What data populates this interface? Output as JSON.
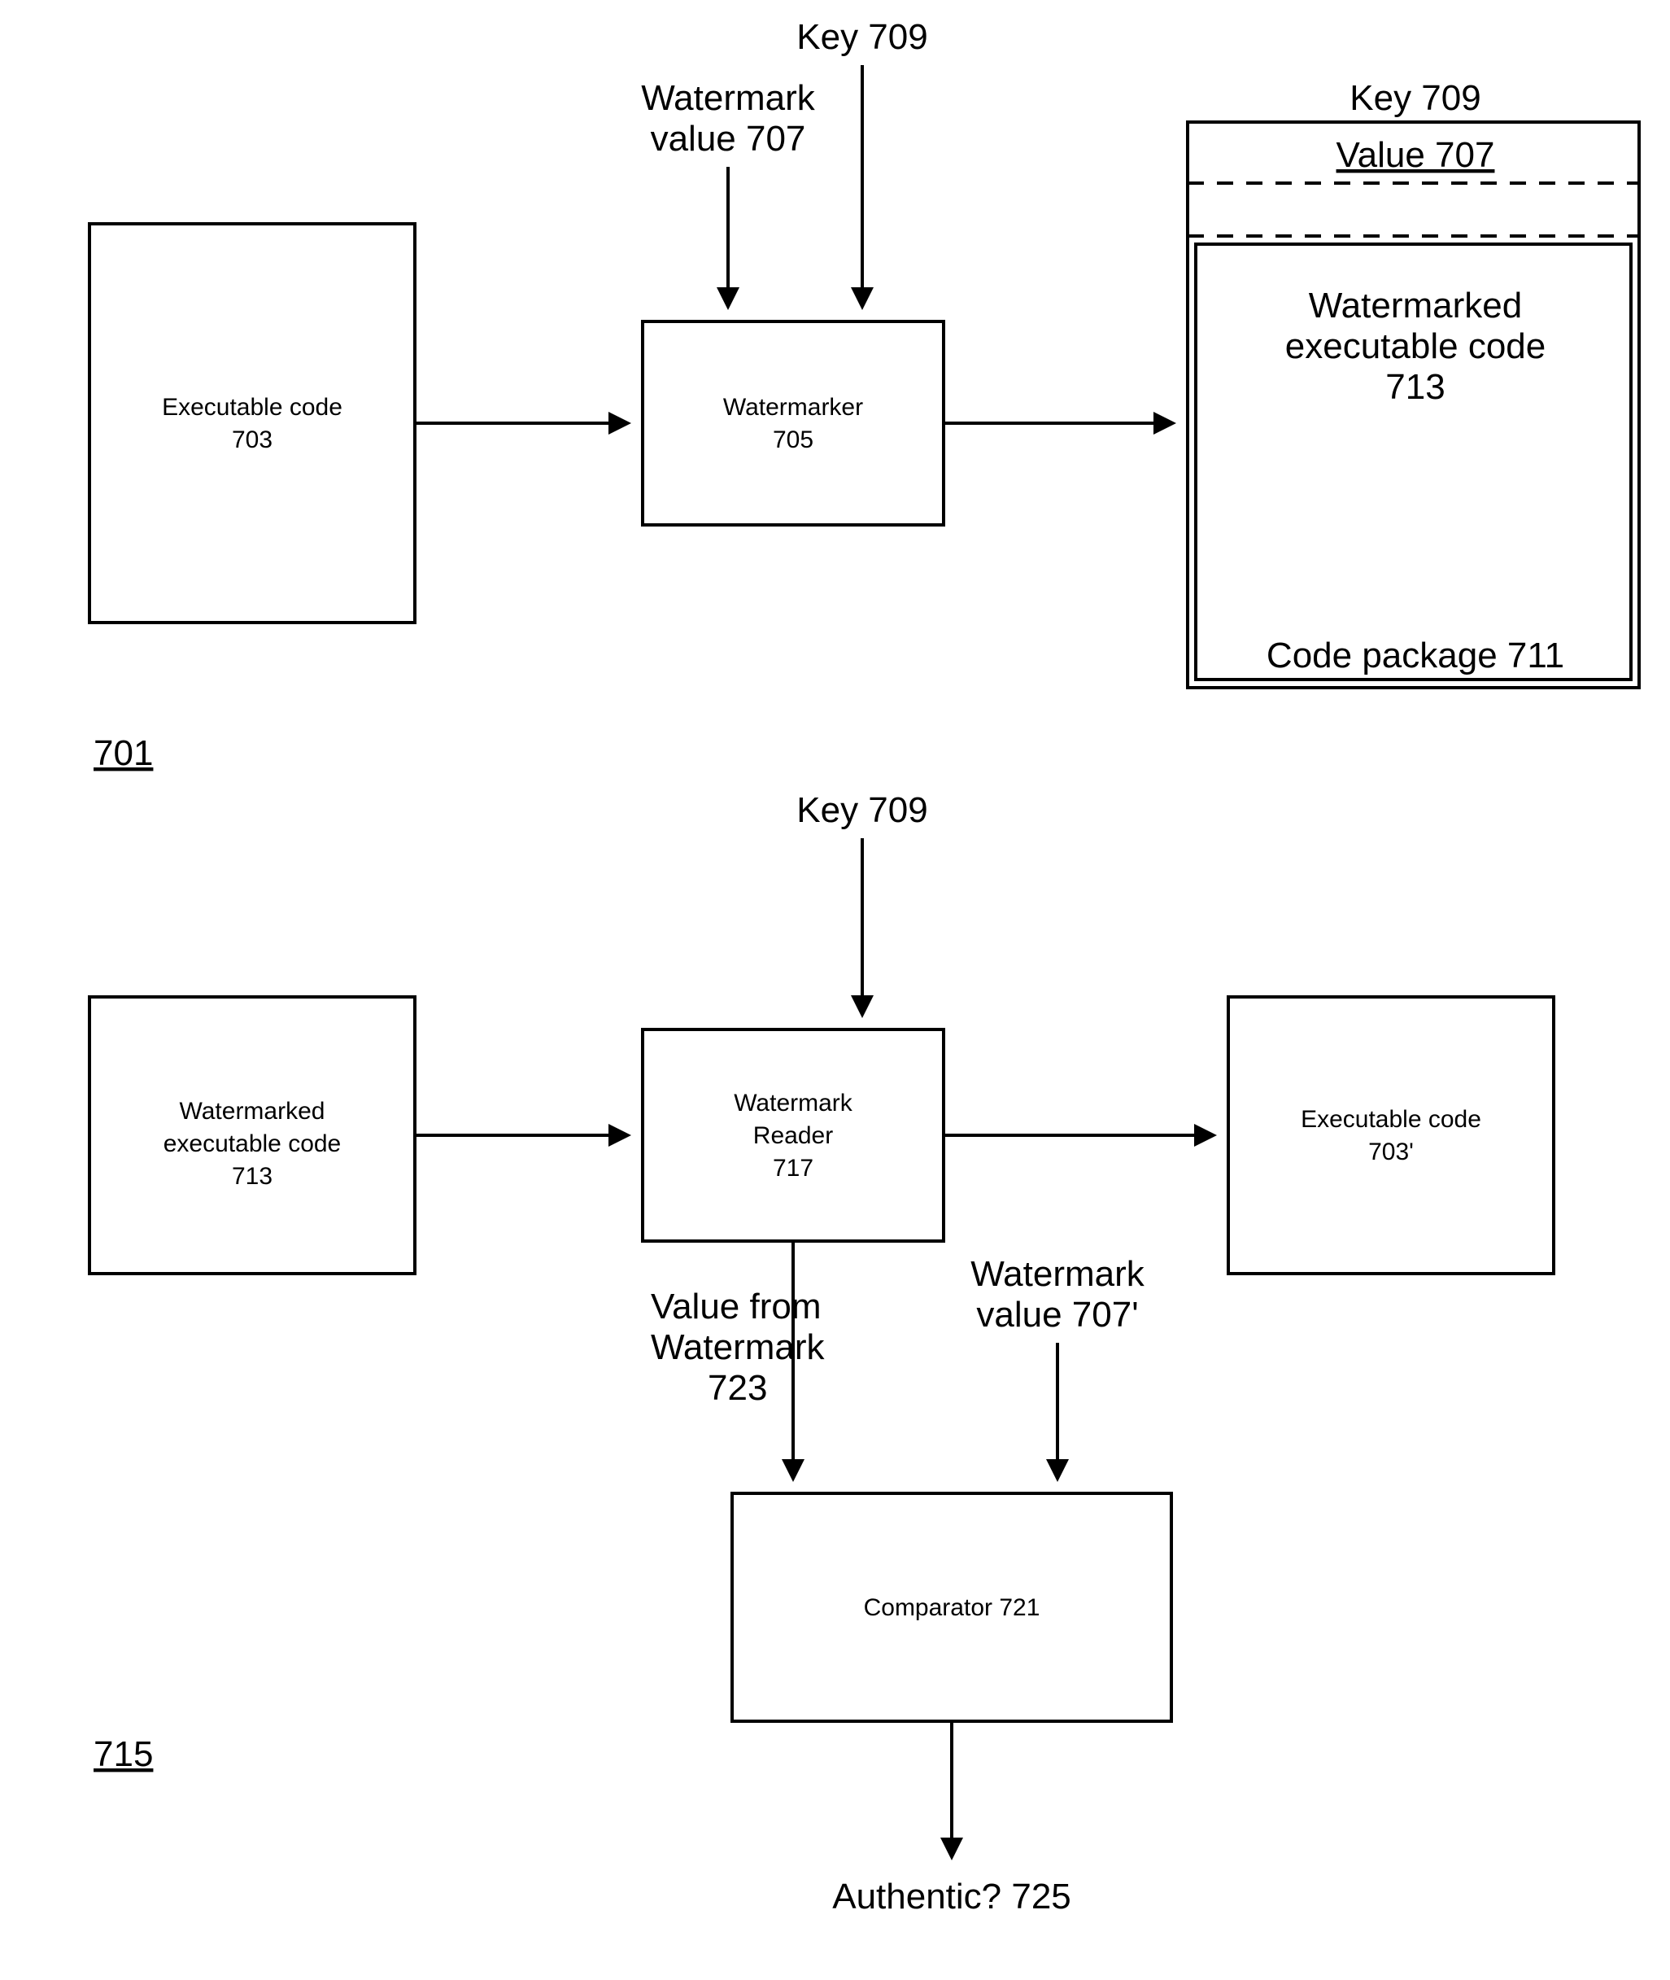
{
  "top": {
    "ref_number": "701",
    "inputs": {
      "key_label": "Key 709",
      "watermark_value_line1": "Watermark",
      "watermark_value_line2": "value 707"
    },
    "exec_code": {
      "line1": "Executable code",
      "line2": "703"
    },
    "watermarker": {
      "line1": "Watermarker",
      "line2": "705"
    },
    "package": {
      "outer_top_label": "Key 709",
      "row_value": "Value 707",
      "body_line1": "Watermarked",
      "body_line2": "executable code",
      "body_line3": "713",
      "footer": "Code package 711"
    }
  },
  "bottom": {
    "ref_number": "715",
    "inputs": {
      "key_label": "Key 709",
      "watermark_value_line1": "Watermark",
      "watermark_value_line2": "value 707'"
    },
    "watermarked_code": {
      "line1": "Watermarked",
      "line2": "executable code",
      "line3": "713"
    },
    "reader": {
      "line1": "Watermark",
      "line2": "Reader",
      "line3": "717"
    },
    "exec_code_out": {
      "line1": "Executable code",
      "line2": "703'"
    },
    "value_from_wm": {
      "line1": "Value from",
      "line2": "Watermark",
      "line3": "723"
    },
    "comparator": {
      "label": "Comparator 721"
    },
    "authentic_label": "Authentic?  725"
  }
}
